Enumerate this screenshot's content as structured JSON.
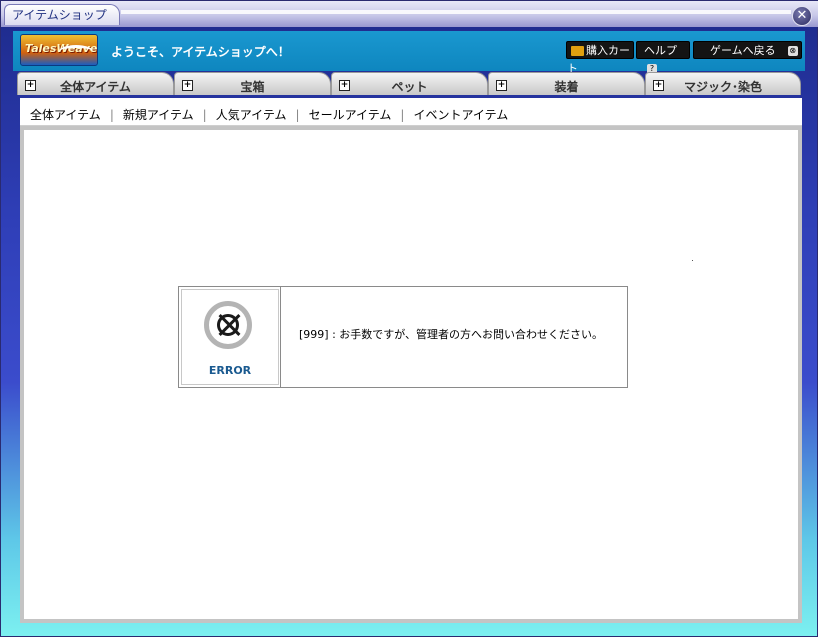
{
  "window": {
    "title": "アイテムショップ",
    "close_icon": "close-icon"
  },
  "header": {
    "logo_text": "TalesWeaver",
    "welcome": "ようこそ、アイテムショップへ！",
    "cart_label": "購入カート",
    "help_label": "ヘルプ",
    "help_badge": "?",
    "back_label": "ゲームへ戻る",
    "back_badge": "⊗"
  },
  "tabs": [
    {
      "label": "全体アイテム"
    },
    {
      "label": "宝箱"
    },
    {
      "label": "ペット"
    },
    {
      "label": "装着"
    },
    {
      "label": "マジック･染色"
    }
  ],
  "subnav": [
    {
      "label": "全体アイテム"
    },
    {
      "label": "新規アイテム"
    },
    {
      "label": "人気アイテム"
    },
    {
      "label": "セールアイテム"
    },
    {
      "label": "イベントアイテム"
    }
  ],
  "error": {
    "label": "ERROR",
    "message": "[999] : お手数ですが、管理者の方へお問い合わせください。"
  },
  "colors": {
    "header_bg": "#1a98d0",
    "error_label": "#1a5a90",
    "tab_bg": "#c8c8c8"
  }
}
